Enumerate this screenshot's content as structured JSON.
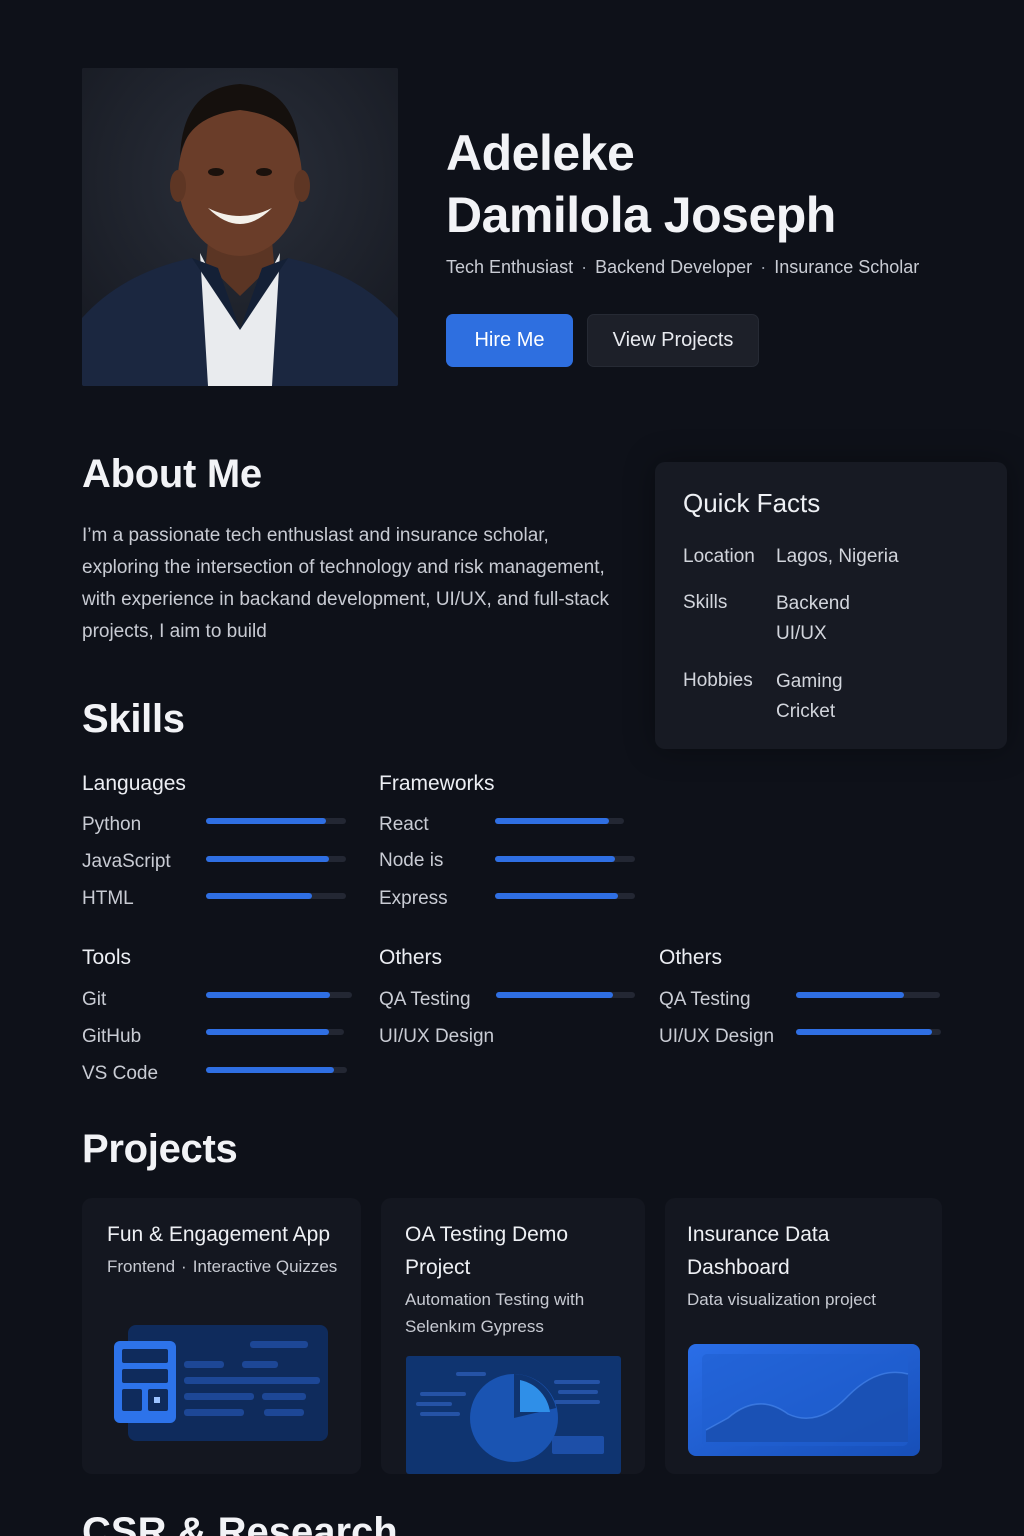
{
  "hero": {
    "name_line1": "Adeleke",
    "name_line2": "Damilola Joseph",
    "tagline": [
      "Tech Enthusiast",
      "Backend Developer",
      "Insurance Scholar"
    ],
    "tagline_separator": "·",
    "hire_button": "Hire Me",
    "projects_button": "View Projects"
  },
  "about": {
    "title": "About Me",
    "text": "I’m a passionate tech enthuslast and insurance scholar, exploring the intersection of technology and risk management, with experience in backand development, UI/UX, and full-stack projects, I aim to build"
  },
  "quick_facts": {
    "title": "Quick Facts",
    "location_label": "Location",
    "location_value": "Lagos, Nigeria",
    "skills_label": "Skills",
    "skills_values": [
      "Backend",
      "UI/UX"
    ],
    "hobbies_label": "Hobbies",
    "hobbies_values": [
      "Gaming",
      "Cricket"
    ]
  },
  "skills": {
    "title": "Skills",
    "groups": [
      {
        "title": "Languages",
        "items": [
          {
            "label": "Python",
            "level": 0.86
          },
          {
            "label": "JavaScript",
            "level": 0.88
          },
          {
            "label": "HTML",
            "level": 0.76
          }
        ]
      },
      {
        "title": "Frameworks",
        "items": [
          {
            "label": "React",
            "level": 0.88
          },
          {
            "label": "Node is",
            "level": 0.86
          },
          {
            "label": "Express",
            "level": 0.88
          }
        ]
      },
      {
        "title": "Tools",
        "items": [
          {
            "label": "Git",
            "level": 0.85
          },
          {
            "label": "GitHub",
            "level": 0.89
          },
          {
            "label": "VS Code",
            "level": 0.91
          }
        ]
      },
      {
        "title": "Others",
        "items": [
          {
            "label": "QA Testing",
            "level": 0.84
          },
          {
            "label": "UI/UX Design",
            "level": null
          }
        ]
      },
      {
        "title": "Others",
        "items": [
          {
            "label": "QA Testing",
            "level": 0.75
          },
          {
            "label": "UI/UX Design",
            "level": 0.94
          }
        ]
      }
    ]
  },
  "projects": {
    "title": "Projects",
    "cards": [
      {
        "title_lines": [
          "Fun & Engagement App"
        ],
        "sub_parts": [
          "Frontend",
          "Interactive Quizzes"
        ]
      },
      {
        "title_lines": [
          "OA Testing Demo",
          "Project"
        ],
        "sub_lines": [
          "Automation Testing with",
          "Selenkım Gypress"
        ]
      },
      {
        "title_lines": [
          "Insurance Data",
          "Dashboard"
        ],
        "sub_lines": [
          "Data visualization project"
        ]
      }
    ]
  },
  "next_section": {
    "title": "CSR & Research"
  },
  "colors": {
    "accent": "#2e6fe0",
    "background": "#0e1119",
    "card": "#141720",
    "bar_track": "#232733"
  }
}
